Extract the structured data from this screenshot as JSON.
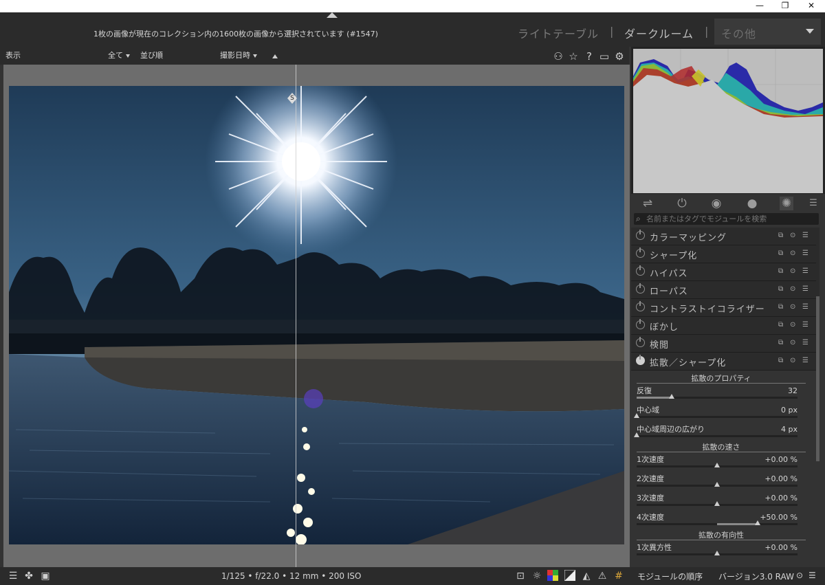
{
  "window": {
    "minimize": "—",
    "maximize": "❐",
    "close": "✕"
  },
  "header": {
    "selection_status": "1枚の画像が現在のコレクション内の1600枚の画像から選択されています (#1547)",
    "tabs": {
      "lighttable": "ライトテーブル",
      "darkroom": "ダークルーム",
      "separator": "|"
    },
    "other_dropdown": "その他"
  },
  "toolbar": {
    "view_label": "表示",
    "filter_value": "全て",
    "sort_label": "並び順",
    "sort_value": "撮影日時",
    "icons": [
      "presets-icon",
      "star-icon",
      "help-icon",
      "keyboard-icon",
      "gear-icon"
    ]
  },
  "image": {
    "split_marker": "S"
  },
  "module_search": {
    "placeholder": "名前またはタグでモジュールを検索"
  },
  "modules": [
    {
      "name": "カラーマッピング",
      "enabled": false
    },
    {
      "name": "シャープ化",
      "enabled": false
    },
    {
      "name": "ハイパス",
      "enabled": false
    },
    {
      "name": "ローパス",
      "enabled": false
    },
    {
      "name": "コントラストイコライザー",
      "enabled": false
    },
    {
      "name": "ぼかし",
      "enabled": false
    },
    {
      "name": "検閲",
      "enabled": false
    },
    {
      "name": "拡散／シャープ化",
      "enabled": true
    }
  ],
  "diffuse": {
    "section1": "拡散のプロパティ",
    "iterations": {
      "label": "反復",
      "value": "32",
      "level": 0.22
    },
    "central_radius": {
      "label": "中心域",
      "value": "0 px",
      "level": 0.0
    },
    "radius_span": {
      "label": "中心域周辺の広がり",
      "value": "4 px",
      "level": 0.0
    },
    "section2": "拡散の速さ",
    "speed1": {
      "label": "1次速度",
      "value": "+0.00 %",
      "level": 0.5
    },
    "speed2": {
      "label": "2次速度",
      "value": "+0.00 %",
      "level": 0.5
    },
    "speed3": {
      "label": "3次速度",
      "value": "+0.00 %",
      "level": 0.5
    },
    "speed4": {
      "label": "4次速度",
      "value": "+50.00 %",
      "level": 0.75
    },
    "section3": "拡散の有向性",
    "anisotropy1": {
      "label": "1次異方性",
      "value": "+0.00 %",
      "level": 0.5
    }
  },
  "bottom": {
    "exif": "1/125 • f/22.0 • 12 mm • 200 ISO",
    "module_order_label": "モジュールの順序",
    "module_order_value": "バージョン3.0 RAW"
  }
}
